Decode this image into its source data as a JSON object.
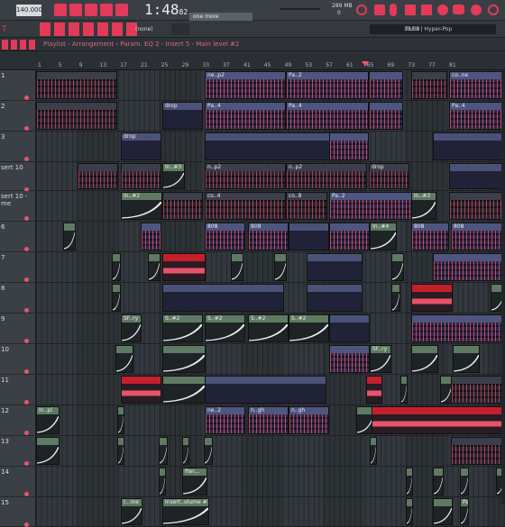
{
  "topbar": {
    "tempo": "140.000",
    "time": "1:48",
    "time_frac": "82",
    "memory": "289 MB",
    "cpu": "0",
    "pattern_name": "one more",
    "none_label": "(none)"
  },
  "toolbar2": {
    "breadcrumb": "Playlist - Arrangement › Param. EQ 2 - Insert 5 - Main level #2",
    "preset": "FLEX | Hyper-Pop",
    "clock": "18:09"
  },
  "ruler": {
    "marks": [
      "1",
      "5",
      "9",
      "13",
      "17",
      "21",
      "25",
      "29",
      "33",
      "37",
      "41",
      "45",
      "49",
      "53",
      "57",
      "61",
      "65",
      "69",
      "73",
      "77",
      "81"
    ]
  },
  "tracks": [
    {
      "num": "1",
      "label": ""
    },
    {
      "num": "2",
      "label": ""
    },
    {
      "num": "3",
      "label": ""
    },
    {
      "num": "",
      "label": "sert 10"
    },
    {
      "num": "",
      "label": "sert 10 - me"
    },
    {
      "num": "6",
      "label": ""
    },
    {
      "num": "7",
      "label": ""
    },
    {
      "num": "8",
      "label": ""
    },
    {
      "num": "9",
      "label": ""
    },
    {
      "num": "10",
      "label": ""
    },
    {
      "num": "11",
      "label": ""
    },
    {
      "num": "12",
      "label": ""
    },
    {
      "num": "13",
      "label": ""
    },
    {
      "num": "14",
      "label": ""
    },
    {
      "num": "15",
      "label": ""
    }
  ],
  "clips": {
    "t1": [
      "ne..p2",
      "ne..p2",
      "ne..p2",
      "Pa..2",
      "Pa..2",
      "co..ne",
      "co..ne"
    ],
    "t2": [
      "drop",
      "Pa..4",
      "Pa..4",
      "Pa..4",
      "Pa..4",
      "Pa..4"
    ],
    "t3": [
      "drop"
    ],
    "t4": [
      "In..#3",
      "n..p2",
      "n..p2",
      "n..p2",
      "n..p2",
      "drop"
    ],
    "t5": [
      "In..#2",
      "co..4",
      "co..8",
      "Pa..2",
      "Pa..2",
      "In..#3"
    ],
    "t6": [
      "808",
      "808",
      "808",
      "808",
      "In..#4",
      "808",
      "808"
    ],
    "t9": [
      "SF..ry",
      "S..#2",
      "S..#2",
      "S..#2",
      "S..#2",
      "S..#2"
    ],
    "t10": [
      "SF..ry"
    ],
    "t12": [
      "In..pl",
      "ne..2",
      "n..gh",
      "n..gh"
    ],
    "t14": [
      "Pan..."
    ],
    "t15": [
      "I...me",
      "Insert..olume #1",
      "Pan..."
    ]
  }
}
